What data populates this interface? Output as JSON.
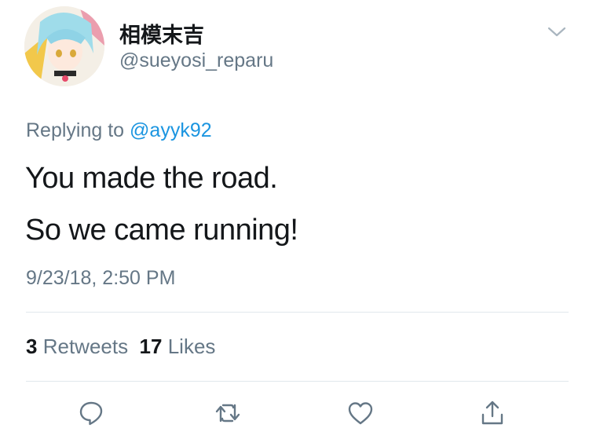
{
  "user": {
    "display_name": "相模末吉",
    "handle": "@sueyosi_reparu"
  },
  "reply": {
    "prefix": "Replying to",
    "mention": "@ayyk92"
  },
  "tweet": {
    "lines": [
      "You made the road.",
      "So we came running!"
    ],
    "timestamp": "9/23/18, 2:50 PM"
  },
  "stats": {
    "retweet_count": "3",
    "retweet_label": "Retweets",
    "like_count": "17",
    "like_label": "Likes"
  },
  "actions": [
    "reply-icon",
    "retweet-icon",
    "like-icon",
    "share-icon"
  ],
  "colors": {
    "text": "#14171a",
    "secondary": "#657786",
    "link": "#1b95e0",
    "divider": "#e1e8ed"
  }
}
